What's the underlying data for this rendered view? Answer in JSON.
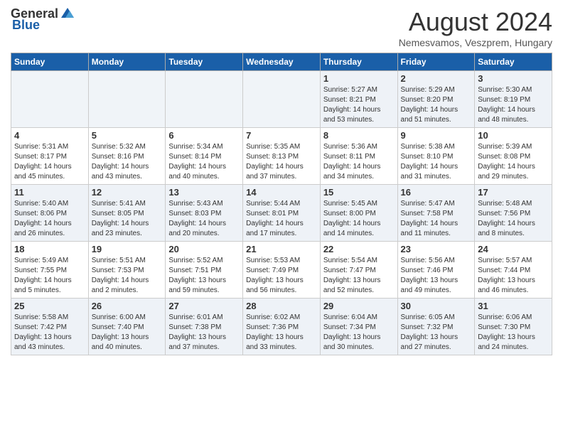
{
  "header": {
    "logo_general": "General",
    "logo_blue": "Blue",
    "month_title": "August 2024",
    "subtitle": "Nemesvamos, Veszprem, Hungary"
  },
  "weekdays": [
    "Sunday",
    "Monday",
    "Tuesday",
    "Wednesday",
    "Thursday",
    "Friday",
    "Saturday"
  ],
  "weeks": [
    {
      "days": [
        {
          "num": "",
          "info": ""
        },
        {
          "num": "",
          "info": ""
        },
        {
          "num": "",
          "info": ""
        },
        {
          "num": "",
          "info": ""
        },
        {
          "num": "1",
          "info": "Sunrise: 5:27 AM\nSunset: 8:21 PM\nDaylight: 14 hours\nand 53 minutes."
        },
        {
          "num": "2",
          "info": "Sunrise: 5:29 AM\nSunset: 8:20 PM\nDaylight: 14 hours\nand 51 minutes."
        },
        {
          "num": "3",
          "info": "Sunrise: 5:30 AM\nSunset: 8:19 PM\nDaylight: 14 hours\nand 48 minutes."
        }
      ]
    },
    {
      "days": [
        {
          "num": "4",
          "info": "Sunrise: 5:31 AM\nSunset: 8:17 PM\nDaylight: 14 hours\nand 45 minutes."
        },
        {
          "num": "5",
          "info": "Sunrise: 5:32 AM\nSunset: 8:16 PM\nDaylight: 14 hours\nand 43 minutes."
        },
        {
          "num": "6",
          "info": "Sunrise: 5:34 AM\nSunset: 8:14 PM\nDaylight: 14 hours\nand 40 minutes."
        },
        {
          "num": "7",
          "info": "Sunrise: 5:35 AM\nSunset: 8:13 PM\nDaylight: 14 hours\nand 37 minutes."
        },
        {
          "num": "8",
          "info": "Sunrise: 5:36 AM\nSunset: 8:11 PM\nDaylight: 14 hours\nand 34 minutes."
        },
        {
          "num": "9",
          "info": "Sunrise: 5:38 AM\nSunset: 8:10 PM\nDaylight: 14 hours\nand 31 minutes."
        },
        {
          "num": "10",
          "info": "Sunrise: 5:39 AM\nSunset: 8:08 PM\nDaylight: 14 hours\nand 29 minutes."
        }
      ]
    },
    {
      "days": [
        {
          "num": "11",
          "info": "Sunrise: 5:40 AM\nSunset: 8:06 PM\nDaylight: 14 hours\nand 26 minutes."
        },
        {
          "num": "12",
          "info": "Sunrise: 5:41 AM\nSunset: 8:05 PM\nDaylight: 14 hours\nand 23 minutes."
        },
        {
          "num": "13",
          "info": "Sunrise: 5:43 AM\nSunset: 8:03 PM\nDaylight: 14 hours\nand 20 minutes."
        },
        {
          "num": "14",
          "info": "Sunrise: 5:44 AM\nSunset: 8:01 PM\nDaylight: 14 hours\nand 17 minutes."
        },
        {
          "num": "15",
          "info": "Sunrise: 5:45 AM\nSunset: 8:00 PM\nDaylight: 14 hours\nand 14 minutes."
        },
        {
          "num": "16",
          "info": "Sunrise: 5:47 AM\nSunset: 7:58 PM\nDaylight: 14 hours\nand 11 minutes."
        },
        {
          "num": "17",
          "info": "Sunrise: 5:48 AM\nSunset: 7:56 PM\nDaylight: 14 hours\nand 8 minutes."
        }
      ]
    },
    {
      "days": [
        {
          "num": "18",
          "info": "Sunrise: 5:49 AM\nSunset: 7:55 PM\nDaylight: 14 hours\nand 5 minutes."
        },
        {
          "num": "19",
          "info": "Sunrise: 5:51 AM\nSunset: 7:53 PM\nDaylight: 14 hours\nand 2 minutes."
        },
        {
          "num": "20",
          "info": "Sunrise: 5:52 AM\nSunset: 7:51 PM\nDaylight: 13 hours\nand 59 minutes."
        },
        {
          "num": "21",
          "info": "Sunrise: 5:53 AM\nSunset: 7:49 PM\nDaylight: 13 hours\nand 56 minutes."
        },
        {
          "num": "22",
          "info": "Sunrise: 5:54 AM\nSunset: 7:47 PM\nDaylight: 13 hours\nand 52 minutes."
        },
        {
          "num": "23",
          "info": "Sunrise: 5:56 AM\nSunset: 7:46 PM\nDaylight: 13 hours\nand 49 minutes."
        },
        {
          "num": "24",
          "info": "Sunrise: 5:57 AM\nSunset: 7:44 PM\nDaylight: 13 hours\nand 46 minutes."
        }
      ]
    },
    {
      "days": [
        {
          "num": "25",
          "info": "Sunrise: 5:58 AM\nSunset: 7:42 PM\nDaylight: 13 hours\nand 43 minutes."
        },
        {
          "num": "26",
          "info": "Sunrise: 6:00 AM\nSunset: 7:40 PM\nDaylight: 13 hours\nand 40 minutes."
        },
        {
          "num": "27",
          "info": "Sunrise: 6:01 AM\nSunset: 7:38 PM\nDaylight: 13 hours\nand 37 minutes."
        },
        {
          "num": "28",
          "info": "Sunrise: 6:02 AM\nSunset: 7:36 PM\nDaylight: 13 hours\nand 33 minutes."
        },
        {
          "num": "29",
          "info": "Sunrise: 6:04 AM\nSunset: 7:34 PM\nDaylight: 13 hours\nand 30 minutes."
        },
        {
          "num": "30",
          "info": "Sunrise: 6:05 AM\nSunset: 7:32 PM\nDaylight: 13 hours\nand 27 minutes."
        },
        {
          "num": "31",
          "info": "Sunrise: 6:06 AM\nSunset: 7:30 PM\nDaylight: 13 hours\nand 24 minutes."
        }
      ]
    }
  ]
}
